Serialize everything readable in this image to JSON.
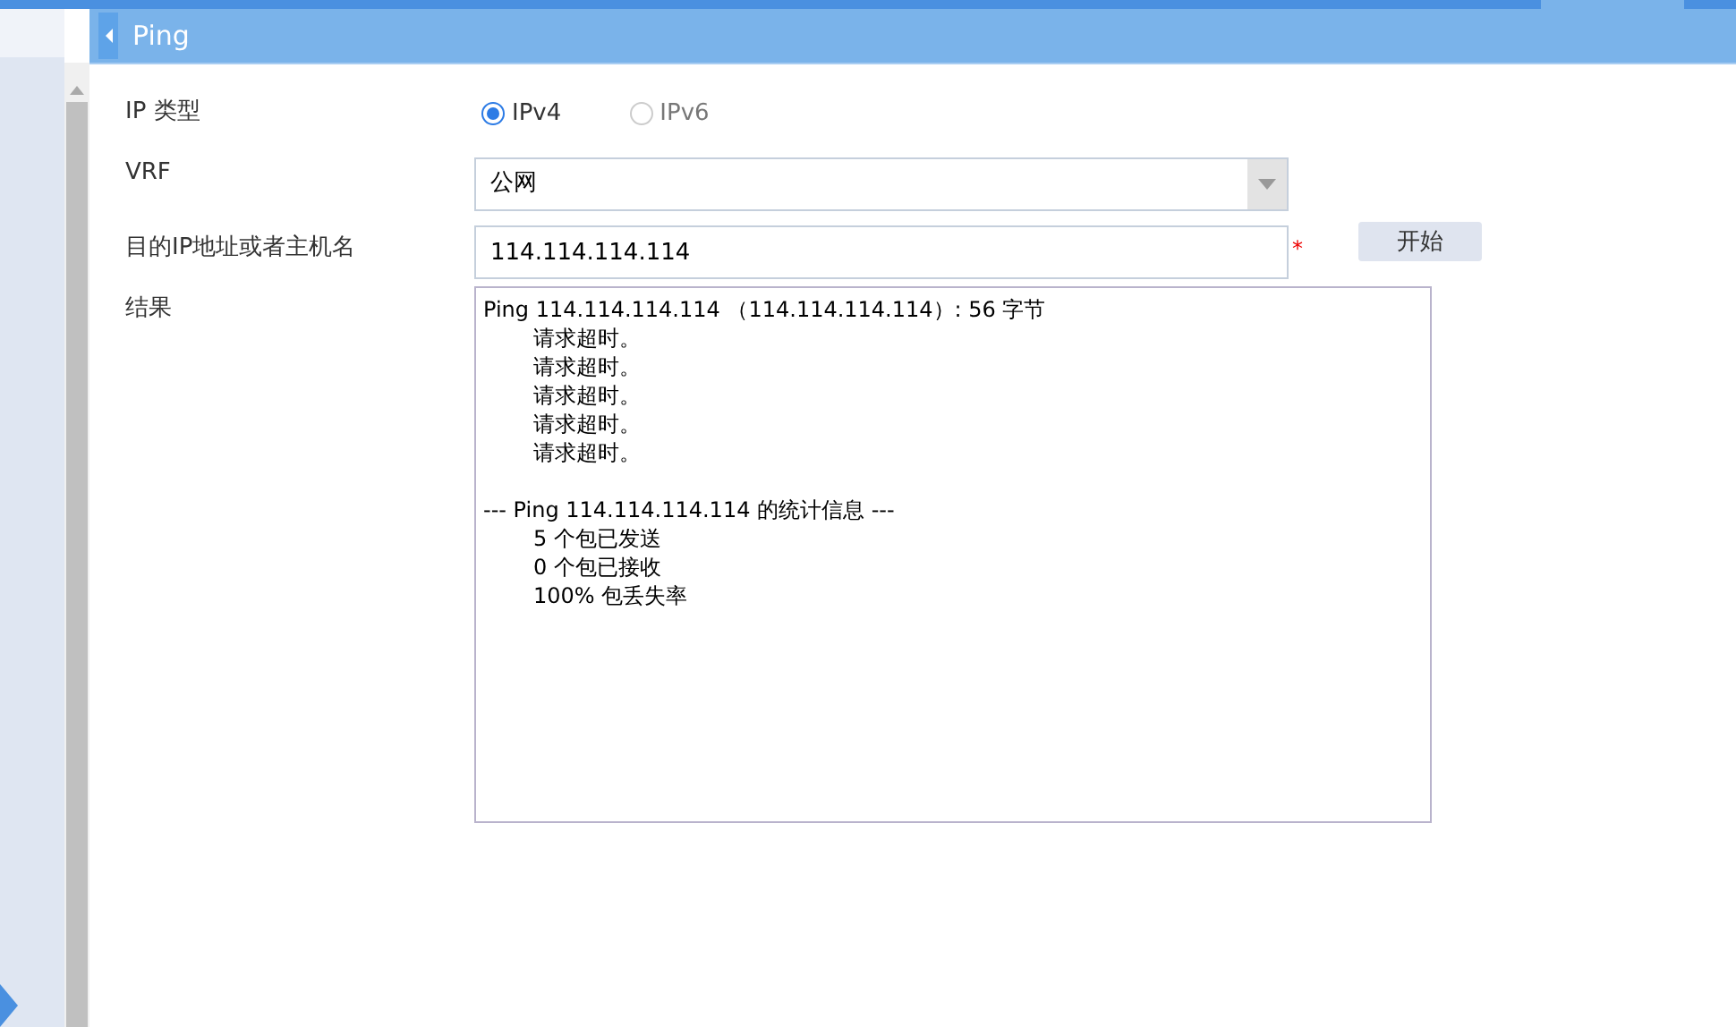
{
  "header": {
    "title": "Ping"
  },
  "form": {
    "ip_type": {
      "label": "IP 类型",
      "options": [
        {
          "label": "IPv4",
          "selected": true
        },
        {
          "label": "IPv6",
          "selected": false
        }
      ]
    },
    "vrf": {
      "label": "VRF",
      "value": "公网"
    },
    "target": {
      "label": "目的IP地址或者主机名",
      "value": "114.114.114.114",
      "required_mark": "*"
    },
    "start_button": "开始",
    "result": {
      "label": "结果",
      "blocks": [
        {
          "heading": "Ping 114.114.114.114 （114.114.114.114）: 56 字节",
          "lines": [
            "请求超时。",
            "请求超时。",
            "请求超时。",
            "请求超时。",
            "请求超时。"
          ]
        },
        {
          "heading": "--- Ping 114.114.114.114 的统计信息 ---",
          "lines": [
            "5 个包已发送",
            "0 个包已接收",
            "100% 包丢失率"
          ]
        }
      ]
    }
  }
}
